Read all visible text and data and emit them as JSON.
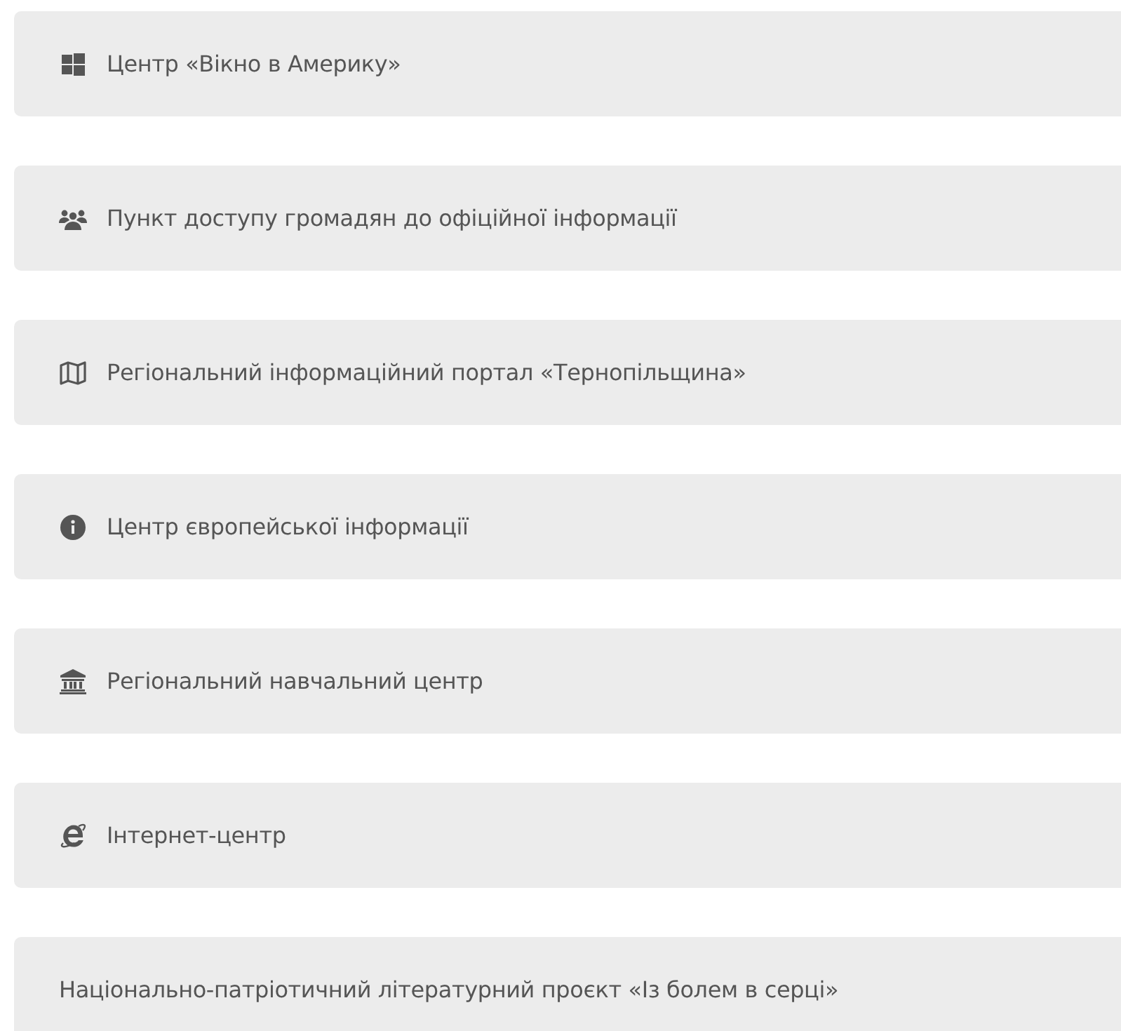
{
  "links": [
    {
      "kind": "windows",
      "label": "Центр «Вікно в Америку»"
    },
    {
      "kind": "users",
      "label": "Пункт доступу громадян до офіційної інформації"
    },
    {
      "kind": "map",
      "label": "Регіональний інформаційний портал «Тернопільщина»"
    },
    {
      "kind": "info",
      "label": "Центр європейської інформації"
    },
    {
      "kind": "bank",
      "label": "Регіональний навчальний центр"
    },
    {
      "kind": "browser",
      "label": "Інтернет-центр"
    },
    {
      "kind": "plain",
      "label": "Національно-патріотичний літературний проєкт «Із болем в серці»"
    }
  ]
}
